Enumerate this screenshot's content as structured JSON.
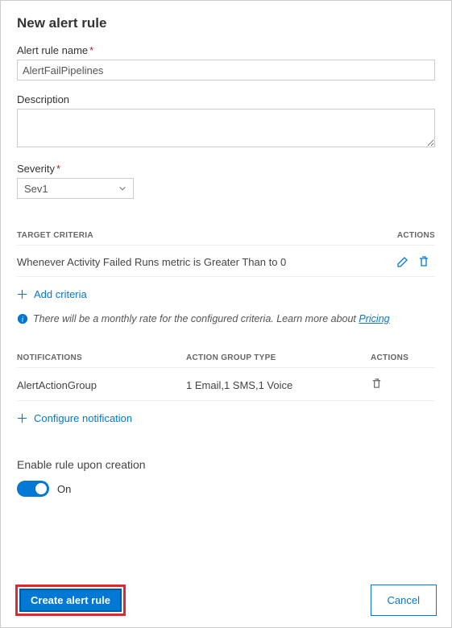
{
  "title": "New alert rule",
  "fields": {
    "name_label": "Alert rule name",
    "name_value": "AlertFailPipelines",
    "desc_label": "Description",
    "desc_value": "",
    "severity_label": "Severity",
    "severity_value": "Sev1"
  },
  "criteria": {
    "target_header": "TARGET CRITERIA",
    "actions_header": "ACTIONS",
    "row_text": "Whenever Activity Failed Runs metric is Greater Than to 0",
    "add_label": "Add criteria",
    "info_text": "There will be a monthly rate for the configured criteria. Learn more about",
    "pricing_link": "Pricing"
  },
  "notifications": {
    "header_notif": "NOTIFICATIONS",
    "header_type": "ACTION GROUP TYPE",
    "header_actions": "ACTIONS",
    "row_name": "AlertActionGroup",
    "row_type": "1 Email,1 SMS,1 Voice",
    "configure_label": "Configure notification"
  },
  "enable": {
    "label": "Enable rule upon creation",
    "state": "On"
  },
  "footer": {
    "create": "Create alert rule",
    "cancel": "Cancel"
  }
}
